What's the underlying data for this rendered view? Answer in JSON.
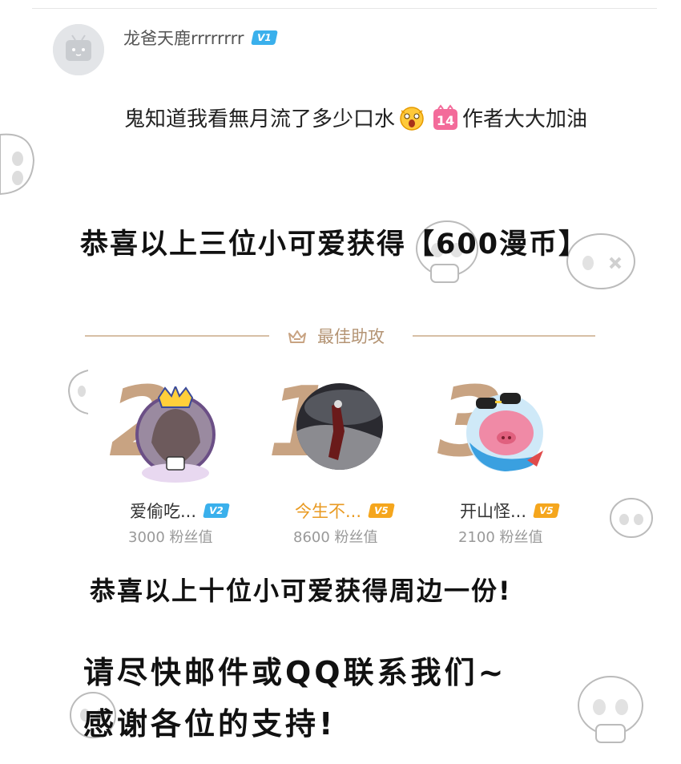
{
  "comment": {
    "username": "龙爸天鹿rrrrrrrr",
    "level_badge": "V1",
    "text_before": "鬼知道我看無月流了多少口水",
    "emoji_1": "surprised-face-emoji",
    "emoji_2_text": "14",
    "text_after": "作者大大加油"
  },
  "headline_1": "恭喜以上三位小可爱获得【600漫币】",
  "section": {
    "icon": "crown-icon",
    "title": "最佳助攻"
  },
  "ranking": [
    {
      "rank": "2",
      "name": "爱偷吃...",
      "badge": "V2",
      "badge_color": "#3ab0ec",
      "value": "3000 粉丝值"
    },
    {
      "rank": "1",
      "name": "今生不...",
      "badge": "V5",
      "badge_color": "#f5a61d",
      "value": "8600 粉丝值"
    },
    {
      "rank": "3",
      "name": "开山怪...",
      "badge": "V5",
      "badge_color": "#f5a61d",
      "value": "2100 粉丝值"
    }
  ],
  "headline_2": "恭喜以上十位小可爱获得周边一份!",
  "headline_3": "请尽快邮件或QQ联系我们~",
  "headline_4": "感谢各位的支持!",
  "colors": {
    "gold_rank": "#c8a382",
    "divider": "#d7bfa6",
    "blue_badge": "#3ab0ec",
    "gold_badge": "#f5a61d"
  }
}
